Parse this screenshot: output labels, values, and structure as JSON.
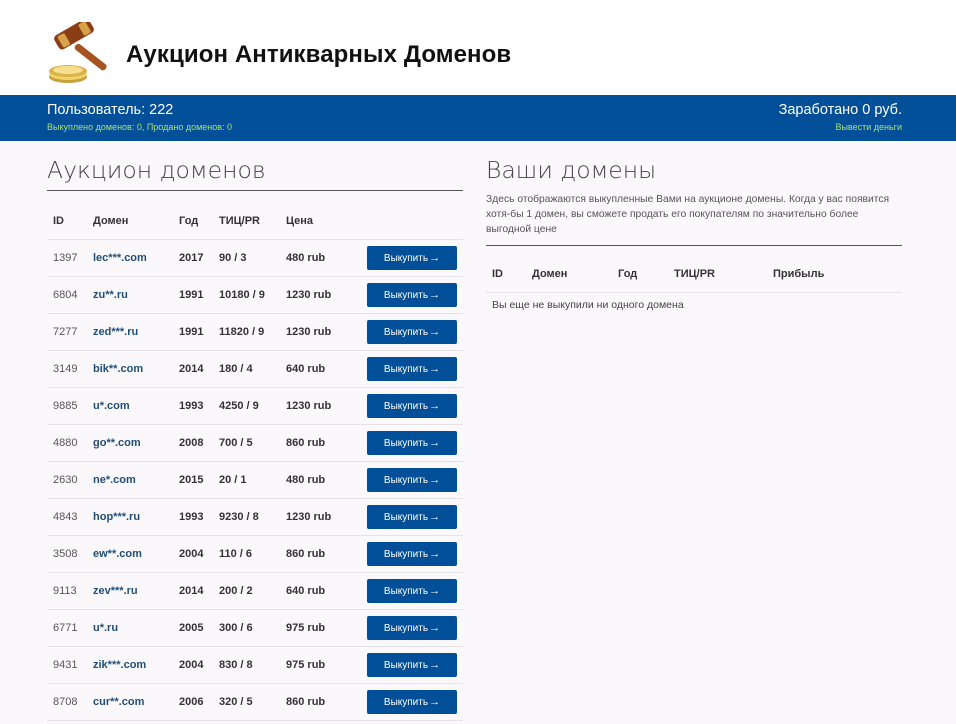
{
  "header": {
    "title": "Аукцион Антикварных Доменов",
    "logo_icon": "gavel-and-coins-icon"
  },
  "userbar": {
    "user": "Пользователь: 222",
    "stats": "Выкуплено доменов: 0, Продано доменов: 0",
    "earned": "Заработано 0 руб.",
    "withdraw": "Вывести деньги"
  },
  "auction": {
    "title": "Аукцион доменов",
    "columns": [
      "ID",
      "Домен",
      "Год",
      "ТИЦ/PR",
      "Цена"
    ],
    "buy_label": "Выкупить",
    "rows": [
      {
        "id": "1397",
        "domain": "lec***.com",
        "year": "2017",
        "tic": "90 / 3",
        "price": "480 rub"
      },
      {
        "id": "6804",
        "domain": "zu**.ru",
        "year": "1991",
        "tic": "10180 / 9",
        "price": "1230 rub"
      },
      {
        "id": "7277",
        "domain": "zed***.ru",
        "year": "1991",
        "tic": "11820 / 9",
        "price": "1230 rub"
      },
      {
        "id": "3149",
        "domain": "bik**.com",
        "year": "2014",
        "tic": "180 / 4",
        "price": "640 rub"
      },
      {
        "id": "9885",
        "domain": "u*.com",
        "year": "1993",
        "tic": "4250 / 9",
        "price": "1230 rub"
      },
      {
        "id": "4880",
        "domain": "go**.com",
        "year": "2008",
        "tic": "700 / 5",
        "price": "860 rub"
      },
      {
        "id": "2630",
        "domain": "ne*.com",
        "year": "2015",
        "tic": "20 / 1",
        "price": "480 rub"
      },
      {
        "id": "4843",
        "domain": "hop***.ru",
        "year": "1993",
        "tic": "9230 / 8",
        "price": "1230 rub"
      },
      {
        "id": "3508",
        "domain": "ew**.com",
        "year": "2004",
        "tic": "110 / 6",
        "price": "860 rub"
      },
      {
        "id": "9113",
        "domain": "zev***.ru",
        "year": "2014",
        "tic": "200 / 2",
        "price": "640 rub"
      },
      {
        "id": "6771",
        "domain": "u*.ru",
        "year": "2005",
        "tic": "300 / 6",
        "price": "975 rub"
      },
      {
        "id": "9431",
        "domain": "zik***.com",
        "year": "2004",
        "tic": "830 / 8",
        "price": "975 rub"
      },
      {
        "id": "8708",
        "domain": "cur**.com",
        "year": "2006",
        "tic": "320 / 5",
        "price": "860 rub"
      }
    ]
  },
  "mine": {
    "title": "Ваши домены",
    "description": "Здесь отображаются выкупленные Вами на аукционе домены. Когда у вас появится хотя-бы 1 домен, вы сможете продать его покупателям по значительно более выгодной цене",
    "columns": [
      "ID",
      "Домен",
      "Год",
      "ТИЦ/PR",
      "Прибыль"
    ],
    "empty": "Вы еще не выкупили ни одного домена"
  }
}
